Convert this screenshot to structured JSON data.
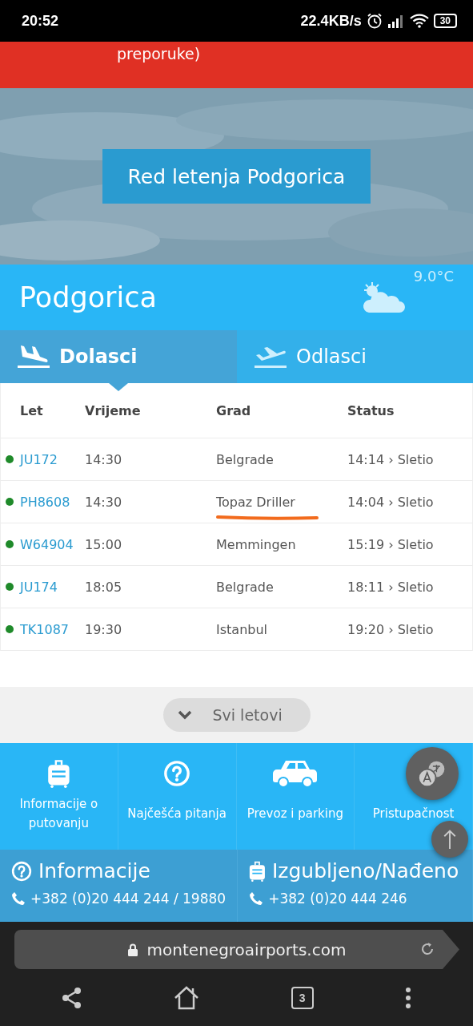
{
  "status_bar": {
    "time": "20:52",
    "speed": "22.4KB/s",
    "battery": "30"
  },
  "alert": {
    "text": "preporuke)"
  },
  "hero": {
    "kind": "picture",
    "button": "Red letenja Podgorica"
  },
  "city": {
    "name": "Podgorica",
    "temperature": "9.0°C"
  },
  "tabs": [
    {
      "label": "Dolasci",
      "kind": "arrival",
      "selected": true
    },
    {
      "label": "Odlasci",
      "kind": "departure",
      "selected": false
    }
  ],
  "table": {
    "columns": [
      "Let",
      "Vrijeme",
      "Grad",
      "Status"
    ],
    "rows": [
      {
        "flight": "JU172",
        "time": "14:30",
        "city": "Belgrade",
        "status": "14:14 › Sletio",
        "underlined": false
      },
      {
        "flight": "PH8608",
        "time": "14:30",
        "city": "Topaz Driller",
        "status": "14:04 › Sletio",
        "underlined": true
      },
      {
        "flight": "W64904",
        "time": "15:00",
        "city": "Memmingen",
        "status": "15:19 › Sletio",
        "underlined": false
      },
      {
        "flight": "JU174",
        "time": "18:05",
        "city": "Belgrade",
        "status": "18:11 › Sletio",
        "underlined": false
      },
      {
        "flight": "TK1087",
        "time": "19:30",
        "city": "Istanbul",
        "status": "19:20 › Sletio",
        "underlined": false
      }
    ]
  },
  "all_flights": "Svi letovi",
  "quick_links": [
    {
      "label": "Informacije o putovanju",
      "kind": "luggage"
    },
    {
      "label": "Najčešća pitanja",
      "kind": "question"
    },
    {
      "label": "Prevoz i parking",
      "kind": "car"
    },
    {
      "label": "Pristupačnost",
      "kind": "none"
    }
  ],
  "contacts": [
    {
      "title": "Informacije",
      "kind": "question",
      "phone": "+382 (0)20 444 244 / 19880"
    },
    {
      "title": "Izgubljeno/Nađeno",
      "kind": "luggage",
      "phone": "+382 (0)20 444 246"
    }
  ],
  "browser": {
    "url": "montenegroairports.com",
    "tab_count": "3"
  }
}
